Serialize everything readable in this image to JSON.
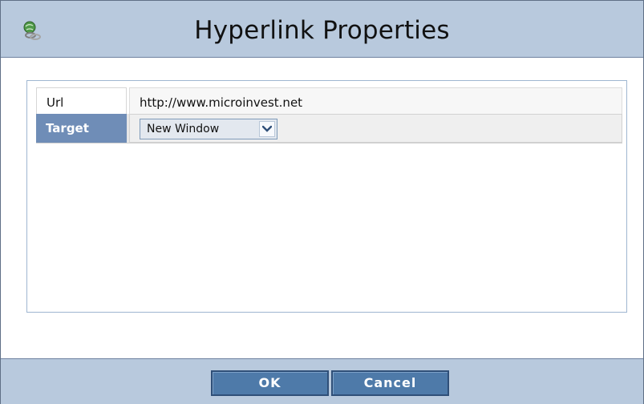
{
  "dialog": {
    "title": "Hyperlink Properties",
    "icon": "globe-link-icon"
  },
  "form": {
    "url": {
      "label": "Url",
      "value": "http://www.microinvest.net"
    },
    "target": {
      "label": "Target",
      "selected": "New Window",
      "dropdown_icon": "chevron-down-icon"
    }
  },
  "buttons": {
    "ok_label": "OK",
    "cancel_label": "Cancel"
  },
  "colors": {
    "titlebar_bg": "#b8c9dd",
    "label_header_bg": "#6f8db7",
    "button_bg": "#4e7aa9"
  }
}
